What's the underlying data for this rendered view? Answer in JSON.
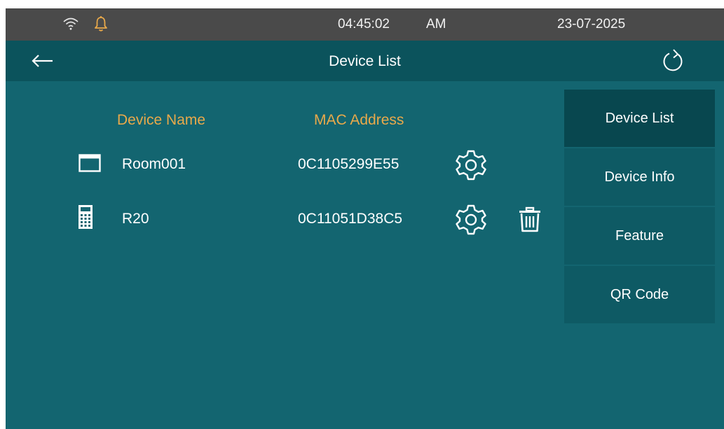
{
  "status_bar": {
    "time": "04:45:02",
    "ampm": "AM",
    "date": "23-07-2025",
    "icons": [
      "wifi-icon",
      "bell-icon"
    ],
    "bell_color": "#e9a94a"
  },
  "title_bar": {
    "title": "Device List",
    "icons": [
      "back-arrow-icon",
      "refresh-icon"
    ]
  },
  "table": {
    "columns": [
      "Device Name",
      "MAC Address"
    ],
    "rows": [
      {
        "icon": "indoor-monitor-icon",
        "name": "Room001",
        "mac": "0C1105299E55",
        "actions": [
          "settings"
        ]
      },
      {
        "icon": "door-phone-icon",
        "name": "R20",
        "mac": "0C11051D38C5",
        "actions": [
          "settings",
          "delete"
        ]
      }
    ]
  },
  "menu": {
    "items": [
      "Device List",
      "Device Info",
      "Feature",
      "QR Code"
    ],
    "active": "Device List"
  },
  "colors": {
    "background": "#136570",
    "title_bar": "#0b535c",
    "status_bar": "#4a4a4a",
    "header_text": "#e9a94a",
    "menu_item": "#0e5a64",
    "menu_active": "#08474f"
  }
}
